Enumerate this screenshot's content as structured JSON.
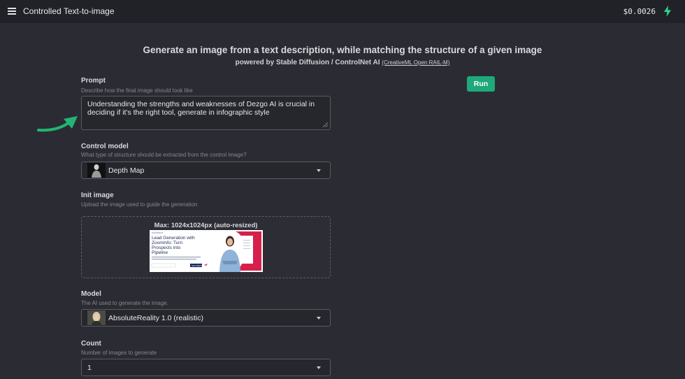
{
  "topbar": {
    "title": "Controlled Text-to-image",
    "balance": "$0.0026",
    "menu_icon": "hamburger-menu-icon",
    "bolt_icon": "lightning-bolt-icon",
    "bolt_color": "#2bd98f"
  },
  "header": {
    "headline": "Generate an image from a text description, while matching the structure of a given image",
    "powered_by": "powered by Stable Diffusion / ControlNet AI",
    "license_link": "(CreativeML Open RAIL-M)"
  },
  "prompt": {
    "label": "Prompt",
    "hint": "Describe how the final image should look like",
    "value": "Understanding the strengths and weaknesses of Dezgo AI is crucial in deciding if it's the right tool, generate in infographic style"
  },
  "control_model": {
    "label": "Control model",
    "hint": "What type of structure should be extracted from the control image?",
    "selected": "Depth Map"
  },
  "init_image": {
    "label": "Init image",
    "hint": "Upload the image used to guide the generation",
    "max_note": "Max: 1024x1024px (auto-resized)",
    "preview": {
      "tag": "ZOOMINFO",
      "headline": "Lead Generation with ZoomInfo: Turn Prospects into Pipeline",
      "button": "GET STARTED"
    }
  },
  "model": {
    "label": "Model",
    "hint": "The AI used to generate the image.",
    "selected": "AbsoluteReality 1.0 (realistic)"
  },
  "count": {
    "label": "Count",
    "hint": "Number of images to generate",
    "selected": "1"
  },
  "actions": {
    "run_label": "Run",
    "run_color": "#1fa87a"
  },
  "annotation": {
    "arrow_icon": "green-curved-arrow-icon",
    "arrow_color": "#22b573"
  }
}
